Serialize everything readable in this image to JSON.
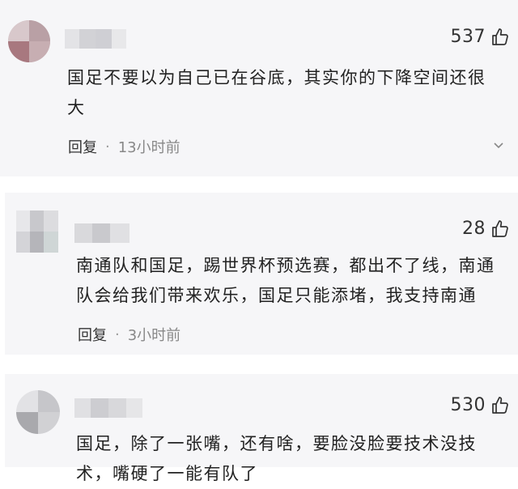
{
  "comments": [
    {
      "likes": "537",
      "text_lines": [
        "国足不要以为自己已在谷底，其实你的下降空间还很",
        "大"
      ],
      "reply_label": "回复",
      "separator": "·",
      "time": "13小时前"
    },
    {
      "likes": "28",
      "text_lines": [
        "南通队和国足，踢世界杯预选赛，都出不了线，南通",
        "队会给我们带来欢乐，国足只能添堵，我支持南通"
      ],
      "reply_label": "回复",
      "separator": "·",
      "time": "3小时前"
    },
    {
      "likes": "530",
      "text_lines": [
        "国足，除了一张嘴，还有啥，要脸没脸要技术没技",
        "术，嘴硬了一能有队了"
      ]
    }
  ],
  "icons": {
    "like": "thumbs-up-icon",
    "more": "chevron-down-icon"
  }
}
